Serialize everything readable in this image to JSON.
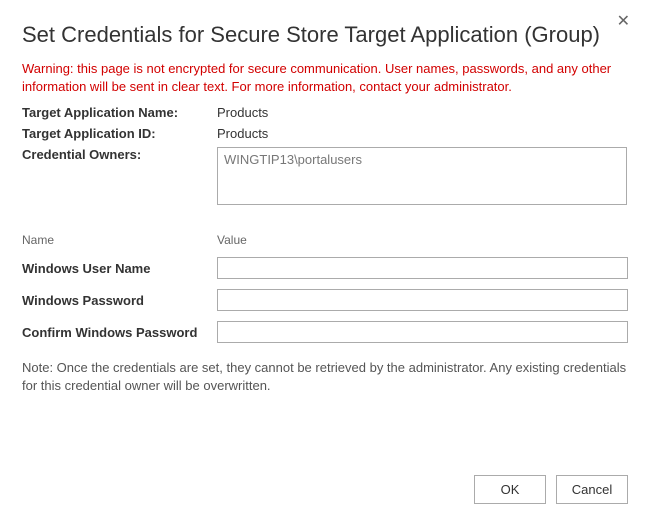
{
  "title": "Set Credentials for Secure Store Target Application (Group)",
  "warning": "Warning: this page is not encrypted for secure communication. User names, passwords, and any other information will be sent in clear text. For more information, contact your administrator.",
  "info": {
    "app_name_label": "Target Application Name:",
    "app_name_value": "Products",
    "app_id_label": "Target Application ID:",
    "app_id_value": "Products",
    "owners_label": "Credential Owners:",
    "owners_value": "WINGTIP13\\portalusers"
  },
  "columns": {
    "name": "Name",
    "value": "Value"
  },
  "credentials": {
    "username_label": "Windows User Name",
    "username_value": "",
    "password_label": "Windows Password",
    "password_value": "",
    "confirm_label": "Confirm Windows Password",
    "confirm_value": ""
  },
  "note": "Note: Once the credentials are set, they cannot be retrieved by the administrator. Any existing credentials for this credential owner will be overwritten.",
  "buttons": {
    "ok": "OK",
    "cancel": "Cancel"
  }
}
